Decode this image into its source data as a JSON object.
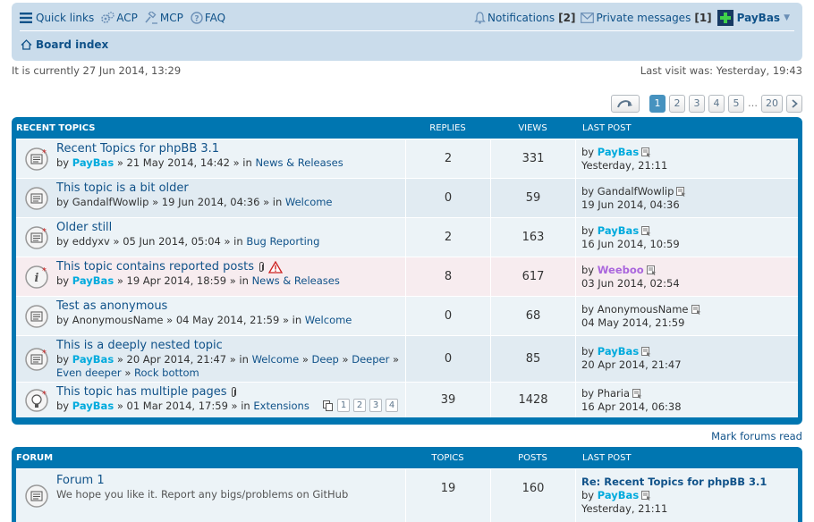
{
  "nav": {
    "quick_links": "Quick links",
    "acp": "ACP",
    "mcp": "MCP",
    "faq": "FAQ",
    "notifications": "Notifications",
    "notifications_count": "[2]",
    "private_messages": "Private messages",
    "pm_count": "[1]",
    "username": "PayBas",
    "board_index": "Board index"
  },
  "info": {
    "current_time": "It is currently 27 Jun 2014, 13:29",
    "last_visit": "Last visit was: Yesterday, 19:43"
  },
  "pagination": {
    "pages": [
      "1",
      "2",
      "3",
      "4",
      "5"
    ],
    "ellipsis": "…",
    "last": "20",
    "active": "1"
  },
  "recent": {
    "header": {
      "title": "RECENT TOPICS",
      "replies": "REPLIES",
      "views": "VIEWS",
      "last_post": "LAST POST"
    },
    "rows": [
      {
        "title": "Recent Topics for phpBB 3.1",
        "by": "by",
        "author": "PayBas",
        "date": "» 21 May 2014, 14:42 » in",
        "forum": "News & Releases",
        "replies": "2",
        "views": "331",
        "lp_by": "by",
        "lp_user": "PayBas",
        "lp_date": "Yesterday, 21:11"
      },
      {
        "title": "This topic is a bit older",
        "by": "by",
        "author": "GandalfWowlip",
        "date": "» 19 Jun 2014, 04:36 » in",
        "forum": "Welcome",
        "replies": "0",
        "views": "59",
        "lp_by": "by",
        "lp_user": "GandalfWowlip",
        "lp_date": "19 Jun 2014, 04:36"
      },
      {
        "title": "Older still",
        "by": "by",
        "author": "eddyxv",
        "date": "» 05 Jun 2014, 05:04 » in",
        "forum": "Bug Reporting",
        "replies": "2",
        "views": "163",
        "lp_by": "by",
        "lp_user": "PayBas",
        "lp_date": "16 Jun 2014, 10:59"
      },
      {
        "title": "This topic contains reported posts",
        "by": "by",
        "author": "PayBas",
        "date": "» 19 Apr 2014, 18:59 » in",
        "forum": "News & Releases",
        "replies": "8",
        "views": "617",
        "lp_by": "by",
        "lp_user": "Weeboo",
        "lp_date": "03 Jun 2014, 02:54"
      },
      {
        "title": "Test as anonymous",
        "by": "by",
        "author": "AnonymousName",
        "date": "» 04 May 2014, 21:59 » in",
        "forum": "Welcome",
        "replies": "0",
        "views": "68",
        "lp_by": "by",
        "lp_user": "AnonymousName",
        "lp_date": "04 May 2014, 21:59"
      },
      {
        "title": "This is a deeply nested topic",
        "by": "by",
        "author": "PayBas",
        "date": "» 20 Apr 2014, 21:47 » in",
        "forum": "Welcome",
        "sep": "»",
        "forum2": "Deep",
        "forum3": "Deeper",
        "forum4": "Even deeper",
        "forum5": "Rock bottom",
        "replies": "0",
        "views": "85",
        "lp_by": "by",
        "lp_user": "PayBas",
        "lp_date": "20 Apr 2014, 21:47"
      },
      {
        "title": "This topic has multiple pages",
        "by": "by",
        "author": "PayBas",
        "date": "» 01 Mar 2014, 17:59 » in",
        "forum": "Extensions",
        "replies": "39",
        "views": "1428",
        "lp_by": "by",
        "lp_user": "Pharia",
        "lp_date": "16 Apr 2014, 06:38",
        "mini_pages": [
          "1",
          "2",
          "3",
          "4"
        ]
      }
    ]
  },
  "mark_read": "Mark forums read",
  "forums": {
    "header": {
      "title": "FORUM",
      "topics": "TOPICS",
      "posts": "POSTS",
      "last_post": "LAST POST"
    },
    "rows": [
      {
        "title": "Forum 1",
        "desc": "We hope you like it. Report any bigs/problems on GitHub",
        "topics": "19",
        "posts": "160",
        "lp_title": "Re: Recent Topics for phpBB 3.1",
        "lp_by": "by",
        "lp_user": "PayBas",
        "lp_date": "Yesterday, 21:11"
      }
    ]
  }
}
